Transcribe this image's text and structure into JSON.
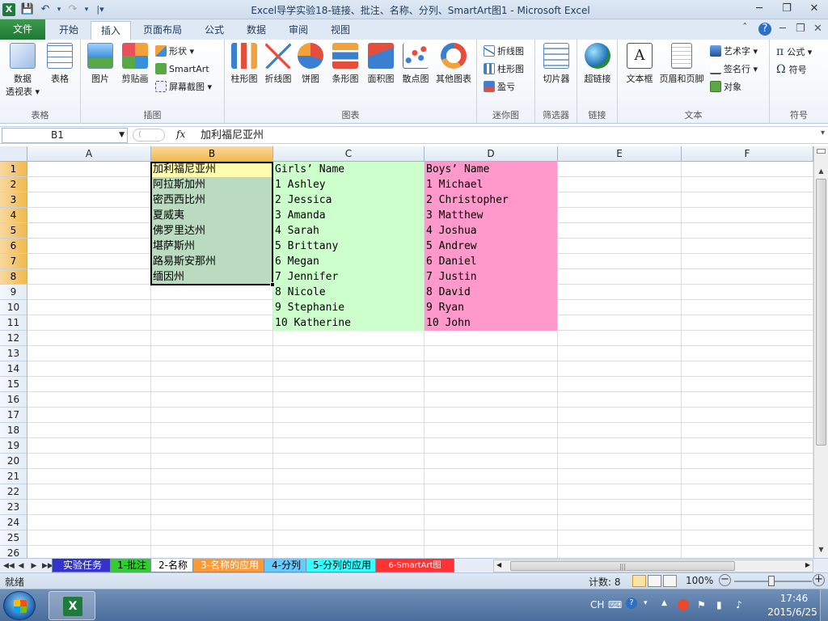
{
  "window": {
    "title": "Excel导学实验18-链接、批注、名称、分列、SmartArt图1 - Microsoft Excel",
    "app_icon": "X",
    "qat": [
      "💾",
      "↶",
      "▾",
      "↷",
      "▾",
      "|▾"
    ],
    "controls": {
      "minimize": "─",
      "restore": "❐",
      "close": "✕"
    }
  },
  "tabs": {
    "file": "文件",
    "items": [
      "开始",
      "插入",
      "页面布局",
      "公式",
      "数据",
      "审阅",
      "视图"
    ],
    "active": "插入",
    "right": [
      "ˆ",
      "?",
      "─",
      "❐",
      "✕"
    ]
  },
  "ribbon": {
    "groups": {
      "tables": "表格",
      "illustrations": "插图",
      "charts": "图表",
      "sparklines": "迷你图",
      "filter": "筛选器",
      "links": "链接",
      "text": "文本",
      "symbols": "符号"
    },
    "buttons": {
      "pivot_line1": "数据",
      "pivot_line2": "透视表 ▾",
      "table": "表格",
      "picture": "图片",
      "clipart": "剪贴画",
      "shapes": "形状 ▾",
      "smartart": "SmartArt",
      "screenshot": "屏幕截图 ▾",
      "column": "柱形图",
      "line": "折线图",
      "pie": "饼图",
      "bar": "条形图",
      "area": "面积图",
      "scatter": "散点图",
      "other": "其他图表",
      "sl_line": "折线图",
      "sl_column": "柱形图",
      "sl_winloss": "盈亏",
      "slicer": "切片器",
      "hyperlink": "超链接",
      "textbox": "文本框",
      "header_footer": "页眉和页脚",
      "wordart": "艺术字 ▾",
      "signature": "签名行 ▾",
      "object": "对象",
      "equation": "公式 ▾",
      "symbol": "符号"
    }
  },
  "formula_bar": {
    "name_box": "B1",
    "fx": "fx",
    "content": "加利福尼亚州"
  },
  "sheet": {
    "columns": [
      "A",
      "B",
      "C",
      "D",
      "E",
      "F"
    ],
    "selected_column": "B",
    "rows": [
      "1",
      "2",
      "3",
      "4",
      "5",
      "6",
      "7",
      "8",
      "9",
      "10",
      "11",
      "12",
      "13",
      "14",
      "15",
      "16",
      "17",
      "18",
      "19",
      "20",
      "21",
      "22",
      "23",
      "24",
      "25",
      "26"
    ],
    "selected_rows": [
      "1",
      "2",
      "3",
      "4",
      "5",
      "6",
      "7",
      "8"
    ],
    "colB": [
      "加利福尼亚州",
      "阿拉斯加州",
      "密西西比州",
      "夏威夷",
      "佛罗里达州",
      "堪萨斯州",
      "路易斯安那州",
      "缅因州"
    ],
    "colC": [
      "Girls’ Name",
      "1 Ashley",
      "2 Jessica",
      "3 Amanda",
      "4 Sarah",
      "5 Brittany",
      "6 Megan",
      "7 Jennifer",
      "8 Nicole",
      "9 Stephanie",
      "10 Katherine"
    ],
    "colD": [
      "Boys’ Name",
      "1 Michael",
      "2 Christopher",
      "3 Matthew",
      "4 Joshua",
      "5 Andrew",
      "6 Daniel",
      "7 Justin",
      "8 David",
      "9 Ryan",
      "10 John"
    ],
    "colors": {
      "B": "#bbdbc0",
      "B1": "#fffcb0",
      "C": "#ccffcc",
      "D": "#ff99cc"
    }
  },
  "sheet_tabs": {
    "nav": [
      "◀◀",
      "◀",
      "▶",
      "▶▶"
    ],
    "tabs": [
      {
        "label": "实验任务",
        "color": "#3333cc",
        "text": "#ffffff"
      },
      {
        "label": "1-批注",
        "color": "#33cc33",
        "text": "#000000"
      },
      {
        "label": "2-名称",
        "color": "#ffffff",
        "text": "#000000"
      },
      {
        "label": "3-名称的应用",
        "color": "#ff9933",
        "text": "#ffffff"
      },
      {
        "label": "4-分列",
        "color": "#66ccff",
        "text": "#000000"
      },
      {
        "label": "5-分列的应用",
        "color": "#33ffff",
        "text": "#000000"
      },
      {
        "label": "6-SmartArt图",
        "color": "#ff3333",
        "text": "#ffffff"
      }
    ],
    "active": "2-名称"
  },
  "status_bar": {
    "ready": "就绪",
    "count": "计数: 8",
    "zoom": "100%"
  },
  "taskbar": {
    "lang": "CH",
    "time": "17:46",
    "date": "2015/6/25"
  }
}
